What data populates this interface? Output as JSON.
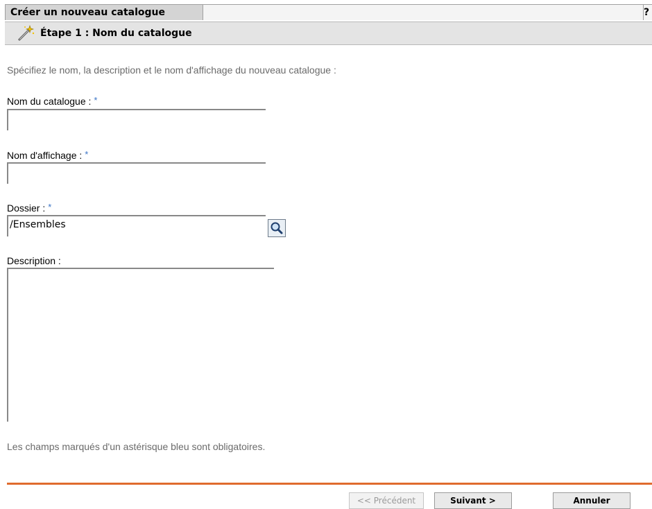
{
  "window": {
    "title": "Créer un nouveau catalogue",
    "help_label": "?"
  },
  "step": {
    "title": "Étape 1 : Nom du catalogue",
    "icon": "wand-icon"
  },
  "intro": "Spécifiez le nom, la description et le nom d'affichage du nouveau catalogue :",
  "fields": {
    "catalog_name": {
      "label": "Nom du catalogue :",
      "required": "*",
      "value": ""
    },
    "display_name": {
      "label": "Nom d'affichage :",
      "required": "*",
      "value": ""
    },
    "folder": {
      "label": "Dossier :",
      "required": "*",
      "value": "/Ensembles",
      "browse_icon": "magnifier-icon"
    },
    "description": {
      "label": "Description :",
      "value": ""
    }
  },
  "footnote": "Les champs marqués d'un astérisque bleu sont obligatoires.",
  "buttons": {
    "previous": "<< Précédent",
    "next": "Suivant >",
    "cancel": "Annuler"
  },
  "colors": {
    "accent_divider": "#e06b2e",
    "required_star": "#3b74c6"
  }
}
